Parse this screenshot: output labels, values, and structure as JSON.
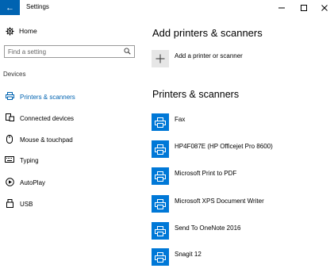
{
  "titlebar": {
    "back_glyph": "←",
    "title": "Settings",
    "minimize": "—",
    "maximize": "☐",
    "close": "✕"
  },
  "sidebar": {
    "home_label": "Home",
    "search_placeholder": "Find a setting",
    "section_label": "Devices",
    "items": [
      {
        "label": "Printers & scanners",
        "icon": "printer-icon",
        "active": true
      },
      {
        "label": "Connected devices",
        "icon": "connected-devices-icon",
        "active": false
      },
      {
        "label": "Mouse & touchpad",
        "icon": "mouse-icon",
        "active": false
      },
      {
        "label": "Typing",
        "icon": "keyboard-icon",
        "active": false
      },
      {
        "label": "AutoPlay",
        "icon": "autoplay-icon",
        "active": false
      },
      {
        "label": "USB",
        "icon": "usb-icon",
        "active": false
      }
    ]
  },
  "main": {
    "add_heading": "Add printers & scanners",
    "add_button_label": "Add a printer or scanner",
    "list_heading": "Printers & scanners",
    "devices": [
      {
        "label": "Fax",
        "icon": "fax-icon"
      },
      {
        "label": "HP4F087E (HP Officejet Pro 8600)",
        "icon": "printer-icon"
      },
      {
        "label": "Microsoft Print to PDF",
        "icon": "printer-icon"
      },
      {
        "label": "Microsoft XPS Document Writer",
        "icon": "printer-icon"
      },
      {
        "label": "Send To OneNote 2016",
        "icon": "printer-icon"
      },
      {
        "label": "Snagit 12",
        "icon": "printer-icon"
      }
    ]
  },
  "colors": {
    "accent": "#0063b1",
    "tile_blue": "#0078d7",
    "tile_grey": "#e6e6e6"
  }
}
